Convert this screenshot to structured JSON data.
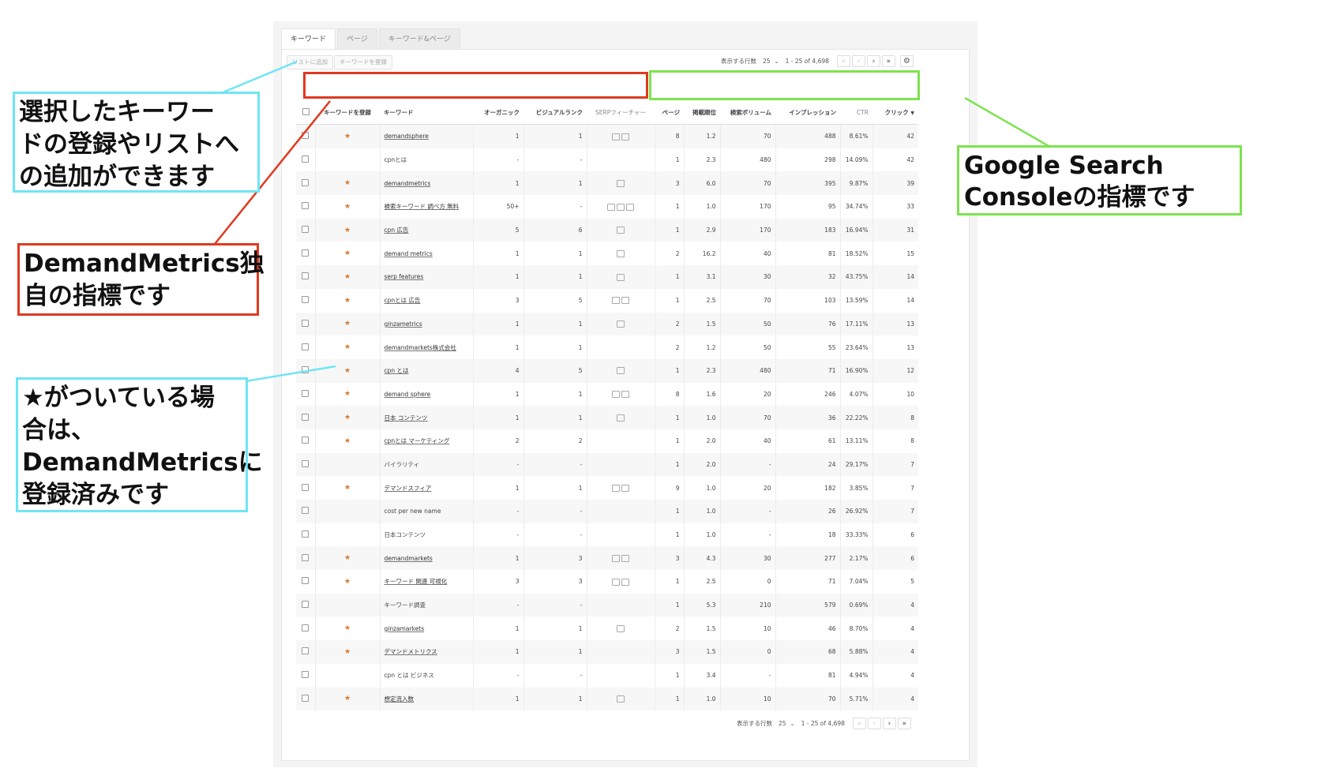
{
  "tabs": [
    "キーワード",
    "ページ",
    "キーワード&ページ"
  ],
  "toolbar": {
    "add_to_list": "リストに追加",
    "register_keyword": "キーワードを登録"
  },
  "pager": {
    "rows_label": "表示する行数",
    "rows_value": "25",
    "range": "1 - 25 of 4,698",
    "first": "«",
    "prev": "‹",
    "next": "›",
    "last": "»",
    "settings_icon": "gear-icon"
  },
  "columns": {
    "register": "キーワードを登録",
    "keyword": "キーワード",
    "organic": "オーガニック",
    "visual": "ビジュアルランク",
    "serp": "SERPフィーチャー",
    "page": "ページ",
    "position": "掲載順位",
    "volume": "検索ボリューム",
    "impressions": "インプレッション",
    "ctr": "CTR",
    "clicks": "クリック"
  },
  "rows": [
    {
      "star": "★",
      "keyword": "demandsphere",
      "link": true,
      "organic": "1",
      "visual": "1",
      "serp": 2,
      "page": "8",
      "position": "1.2",
      "volume": "70",
      "impressions": "488",
      "ctr": "8.61%",
      "clicks": "42"
    },
    {
      "star": "",
      "keyword": "cpnとは",
      "link": false,
      "organic": "-",
      "visual": "-",
      "serp": 0,
      "page": "1",
      "position": "2.3",
      "volume": "480",
      "impressions": "298",
      "ctr": "14.09%",
      "clicks": "42"
    },
    {
      "star": "★",
      "keyword": "demandmetrics",
      "link": true,
      "organic": "1",
      "visual": "1",
      "serp": 1,
      "page": "3",
      "position": "6.0",
      "volume": "70",
      "impressions": "395",
      "ctr": "9.87%",
      "clicks": "39"
    },
    {
      "star": "★",
      "keyword": "検索キーワード 調べ方 無料",
      "link": true,
      "organic": "50+",
      "visual": "-",
      "serp": 3,
      "page": "1",
      "position": "1.0",
      "volume": "170",
      "impressions": "95",
      "ctr": "34.74%",
      "clicks": "33"
    },
    {
      "star": "★",
      "keyword": "cpn 広告",
      "link": true,
      "organic": "5",
      "visual": "6",
      "serp": 1,
      "page": "1",
      "position": "2.9",
      "volume": "170",
      "impressions": "183",
      "ctr": "16.94%",
      "clicks": "31"
    },
    {
      "star": "★",
      "keyword": "demand metrics",
      "link": true,
      "organic": "1",
      "visual": "1",
      "serp": 1,
      "page": "2",
      "position": "16.2",
      "volume": "40",
      "impressions": "81",
      "ctr": "18.52%",
      "clicks": "15"
    },
    {
      "star": "★",
      "keyword": "serp features",
      "link": true,
      "organic": "1",
      "visual": "1",
      "serp": 1,
      "page": "1",
      "position": "3.1",
      "volume": "30",
      "impressions": "32",
      "ctr": "43.75%",
      "clicks": "14"
    },
    {
      "star": "★",
      "keyword": "cpnとは 広告",
      "link": true,
      "organic": "3",
      "visual": "5",
      "serp": 2,
      "page": "1",
      "position": "2.5",
      "volume": "70",
      "impressions": "103",
      "ctr": "13.59%",
      "clicks": "14"
    },
    {
      "star": "★",
      "keyword": "ginzametrics",
      "link": true,
      "organic": "1",
      "visual": "1",
      "serp": 1,
      "page": "2",
      "position": "1.5",
      "volume": "50",
      "impressions": "76",
      "ctr": "17.11%",
      "clicks": "13"
    },
    {
      "star": "★",
      "keyword": "demandmarkets株式会社",
      "link": true,
      "organic": "1",
      "visual": "1",
      "serp": 0,
      "page": "2",
      "position": "1.2",
      "volume": "50",
      "impressions": "55",
      "ctr": "23.64%",
      "clicks": "13"
    },
    {
      "star": "★",
      "keyword": "cpn とは",
      "link": true,
      "organic": "4",
      "visual": "5",
      "serp": 1,
      "page": "1",
      "position": "2.3",
      "volume": "480",
      "impressions": "71",
      "ctr": "16.90%",
      "clicks": "12"
    },
    {
      "star": "★",
      "keyword": "demand sphere",
      "link": true,
      "organic": "1",
      "visual": "1",
      "serp": 2,
      "page": "8",
      "position": "1.6",
      "volume": "20",
      "impressions": "246",
      "ctr": "4.07%",
      "clicks": "10"
    },
    {
      "star": "★",
      "keyword": "日本 コンテンツ",
      "link": true,
      "organic": "1",
      "visual": "1",
      "serp": 1,
      "page": "1",
      "position": "1.0",
      "volume": "70",
      "impressions": "36",
      "ctr": "22.22%",
      "clicks": "8"
    },
    {
      "star": "★",
      "keyword": "cpnとは マーケティング",
      "link": true,
      "organic": "2",
      "visual": "2",
      "serp": 0,
      "page": "1",
      "position": "2.0",
      "volume": "40",
      "impressions": "61",
      "ctr": "13.11%",
      "clicks": "8"
    },
    {
      "star": "",
      "keyword": "バイラリティ",
      "link": false,
      "organic": "-",
      "visual": "-",
      "serp": 0,
      "page": "1",
      "position": "2.0",
      "volume": "-",
      "impressions": "24",
      "ctr": "29.17%",
      "clicks": "7"
    },
    {
      "star": "★",
      "keyword": "デマンドスフィア",
      "link": true,
      "organic": "1",
      "visual": "1",
      "serp": 2,
      "page": "9",
      "position": "1.0",
      "volume": "20",
      "impressions": "182",
      "ctr": "3.85%",
      "clicks": "7"
    },
    {
      "star": "",
      "keyword": "cost per new name",
      "link": false,
      "organic": "-",
      "visual": "-",
      "serp": 0,
      "page": "1",
      "position": "1.0",
      "volume": "-",
      "impressions": "26",
      "ctr": "26.92%",
      "clicks": "7"
    },
    {
      "star": "",
      "keyword": "日本コンテンツ",
      "link": false,
      "organic": "-",
      "visual": "-",
      "serp": 0,
      "page": "1",
      "position": "1.0",
      "volume": "-",
      "impressions": "18",
      "ctr": "33.33%",
      "clicks": "6"
    },
    {
      "star": "★",
      "keyword": "demandmarkets",
      "link": true,
      "organic": "1",
      "visual": "3",
      "serp": 2,
      "page": "3",
      "position": "4.3",
      "volume": "30",
      "impressions": "277",
      "ctr": "2.17%",
      "clicks": "6"
    },
    {
      "star": "★",
      "keyword": "キーワード 関連 可視化",
      "link": true,
      "organic": "3",
      "visual": "3",
      "serp": 2,
      "page": "1",
      "position": "2.5",
      "volume": "0",
      "impressions": "71",
      "ctr": "7.04%",
      "clicks": "5"
    },
    {
      "star": "",
      "keyword": "キーワード調査",
      "link": false,
      "organic": "-",
      "visual": "-",
      "serp": 0,
      "page": "1",
      "position": "5.3",
      "volume": "210",
      "impressions": "579",
      "ctr": "0.69%",
      "clicks": "4"
    },
    {
      "star": "★",
      "keyword": "ginzamarkets",
      "link": true,
      "organic": "1",
      "visual": "1",
      "serp": 1,
      "page": "2",
      "position": "1.5",
      "volume": "10",
      "impressions": "46",
      "ctr": "8.70%",
      "clicks": "4"
    },
    {
      "star": "★",
      "keyword": "デマンドメトリクス",
      "link": true,
      "organic": "1",
      "visual": "1",
      "serp": 0,
      "page": "3",
      "position": "1.5",
      "volume": "0",
      "impressions": "68",
      "ctr": "5.88%",
      "clicks": "4"
    },
    {
      "star": "",
      "keyword": "cpn とは ビジネス",
      "link": false,
      "organic": "-",
      "visual": "-",
      "serp": 0,
      "page": "1",
      "position": "3.4",
      "volume": "-",
      "impressions": "81",
      "ctr": "4.94%",
      "clicks": "4"
    },
    {
      "star": "★",
      "keyword": "想定流入数",
      "link": true,
      "organic": "1",
      "visual": "1",
      "serp": 1,
      "page": "1",
      "position": "1.0",
      "volume": "10",
      "impressions": "70",
      "ctr": "5.71%",
      "clicks": "4"
    }
  ],
  "annotations": {
    "select_register": [
      "選択したキーワー",
      "ドの登録やリストへ",
      "の追加ができます"
    ],
    "demandmetrics_metrics": [
      "DemandMetrics独",
      "自の指標です"
    ],
    "star_registered": [
      "★がついている場",
      "合は、",
      "DemandMetricsに",
      "登録済みです"
    ],
    "gsc_metrics": [
      "Google Search",
      "Consoleの指標です"
    ]
  },
  "colors": {
    "red_highlight": "#e0391f",
    "green_highlight": "#7de34f",
    "cyan_highlight": "#6fe5f4",
    "star": "#d5782f",
    "position": "#e8823a",
    "impressions": "#6a4fc2",
    "ctr": "#3f9d74",
    "clicks": "#3a70c6"
  }
}
